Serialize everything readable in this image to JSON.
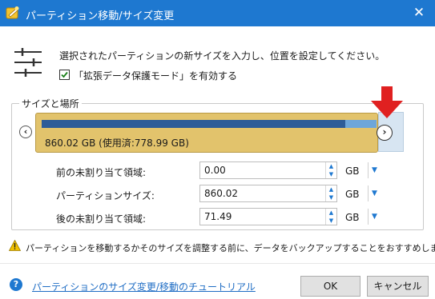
{
  "window": {
    "title": "パーティション移動/サイズ変更",
    "close_glyph": "✕"
  },
  "intro": {
    "text": "選択されたパーティションの新サイズを入力し、位置を設定してください。",
    "checkbox_label": "「拡張データ保護モード」を有効する",
    "checkbox_checked": true
  },
  "group": {
    "legend": "サイズと場所",
    "nav_left": "‹",
    "nav_right": "›",
    "partition_label": "860.02 GB (使用済:778.99 GB)",
    "used_fraction": 0.906,
    "colors": {
      "partition_fill": "#e2c36c",
      "used_bar": "#2d5c98",
      "free_bar": "#6ea6d9",
      "unallocated": "#d7e5f2",
      "pointer_arrow": "#e02020"
    }
  },
  "fields": [
    {
      "label": "前の未割り当て領域:",
      "value": "0.00",
      "unit": "GB"
    },
    {
      "label": "パーティションサイズ:",
      "value": "860.02",
      "unit": "GB"
    },
    {
      "label": "後の未割り当て領域:",
      "value": "71.49",
      "unit": "GB"
    }
  ],
  "spin": {
    "up": "▲",
    "down": "▼",
    "dropdown": "▼"
  },
  "warning": {
    "text": "パーティションを移動するかそのサイズを調整する前に、データをバックアップすることをおすすめします。"
  },
  "footer": {
    "help_glyph": "?",
    "help_link": "パーティションのサイズ変更/移動のチュートリアル",
    "ok_label": "OK",
    "cancel_label": "キャンセル"
  },
  "accent_color": "#1e78d0"
}
